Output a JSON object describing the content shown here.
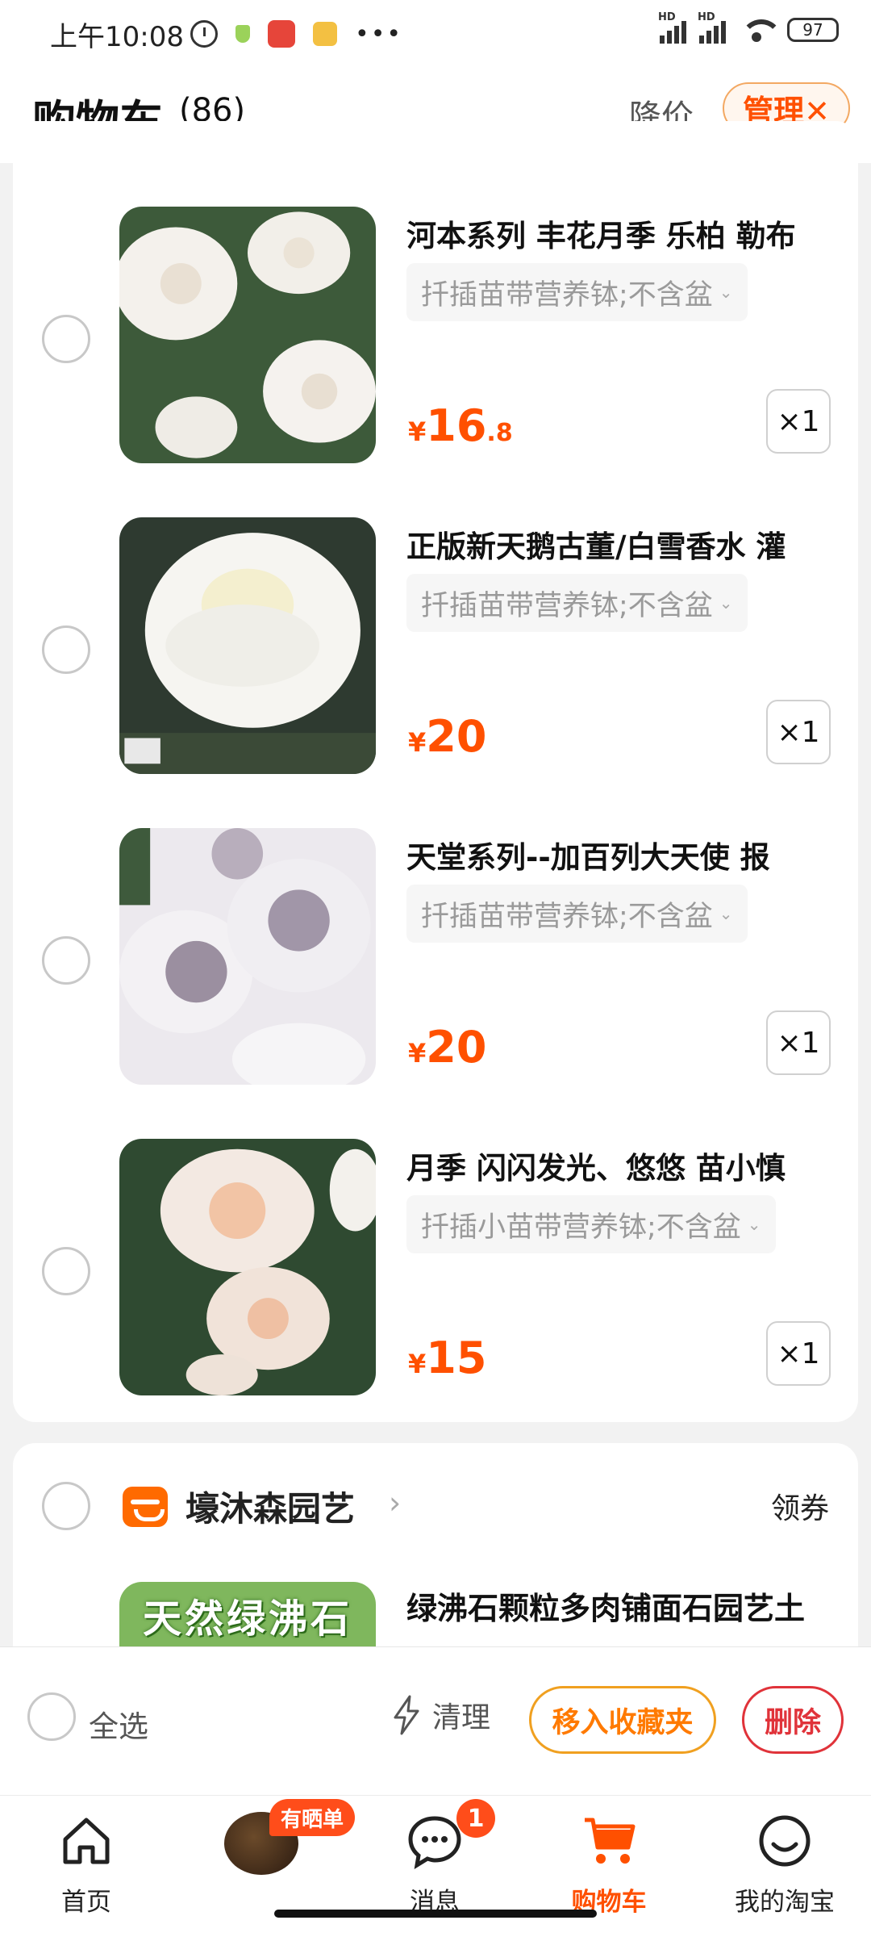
{
  "status_bar": {
    "time": "上午10:08",
    "battery": "97",
    "signal_label": "HD"
  },
  "header": {
    "title": "购物车",
    "count": "(86)",
    "price_drop": "降价",
    "manage": "管理✕"
  },
  "items": [
    {
      "title": "河本系列 丰花月季 乐柏 勒布",
      "spec": "扦插苗带营养钵;不含盆",
      "currency": "¥",
      "price_int": "16",
      "price_dec": ".8",
      "qty": "×1"
    },
    {
      "title": "正版新天鹅古董/白雪香水  灌",
      "spec": "扦插苗带营养钵;不含盆",
      "currency": "¥",
      "price_int": "20",
      "price_dec": "",
      "qty": "×1"
    },
    {
      "title": "天堂系列--加百列大天使  报",
      "spec": "扦插苗带营养钵;不含盆",
      "currency": "¥",
      "price_int": "20",
      "price_dec": "",
      "qty": "×1"
    },
    {
      "title": "月季 闪闪发光、悠悠 苗小慎",
      "spec": "扦插小苗带营养钵;不含盆",
      "currency": "¥",
      "price_int": "15",
      "price_dec": "",
      "qty": "×1"
    }
  ],
  "store2": {
    "name": "壕沐森园艺",
    "coupon": "领券",
    "item_title": "绿沸石颗粒多肉铺面石园艺土",
    "thumb_banner": "天然绿沸石"
  },
  "action_bar": {
    "select_all": "全选",
    "clean": "清理",
    "move_to_fav": "移入收藏夹",
    "delete": "删除"
  },
  "bottom_nav": {
    "home": "首页",
    "feed_badge": "有晒单",
    "messages": "消息",
    "messages_badge": "1",
    "cart": "购物车",
    "mine": "我的淘宝"
  },
  "colors": {
    "accent": "#ff5000",
    "favorite": "#f0a020",
    "delete": "#e0333a"
  }
}
